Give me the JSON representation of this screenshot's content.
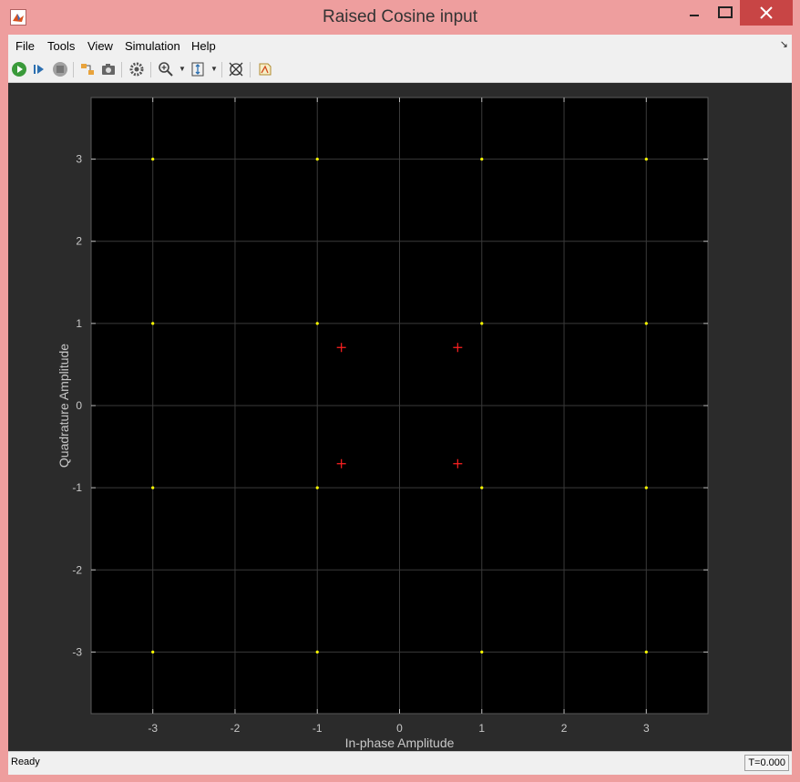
{
  "window": {
    "title": "Raised Cosine input"
  },
  "menu": {
    "file": "File",
    "tools": "Tools",
    "view": "View",
    "simulation": "Simulation",
    "help": "Help"
  },
  "toolbar": {
    "icons": [
      "run-icon",
      "step-forward-icon",
      "stop-icon",
      "highlight-block-icon",
      "snapshot-icon",
      "settings-icon",
      "zoom-in-icon",
      "scale-axes-icon",
      "axes-limits-icon",
      "print-icon"
    ]
  },
  "status": {
    "text": "Ready",
    "time": "T=0.000"
  },
  "colors": {
    "plot_bg": "#000000",
    "panel_bg": "#2b2b2b",
    "grid": "#3a3a3a",
    "axis_text": "#c8c8c8",
    "received_points": "#ffff00",
    "reference_points": "#ff2020"
  },
  "chart_data": {
    "type": "scatter",
    "title": "",
    "xlabel": "In-phase Amplitude",
    "ylabel": "Quadrature Amplitude",
    "xlim": [
      -3.75,
      3.75
    ],
    "ylim": [
      -3.75,
      3.75
    ],
    "xticks": [
      -3,
      -2,
      -1,
      0,
      1,
      2,
      3
    ],
    "yticks": [
      -3,
      -2,
      -1,
      0,
      1,
      2,
      3
    ],
    "grid": true,
    "series": [
      {
        "marker": "dot",
        "color": "#ffff00",
        "points": [
          [
            -3,
            3
          ],
          [
            -1,
            3
          ],
          [
            1,
            3
          ],
          [
            3,
            3
          ],
          [
            -3,
            1
          ],
          [
            -1,
            1
          ],
          [
            1,
            1
          ],
          [
            3,
            1
          ],
          [
            -3,
            -1
          ],
          [
            -1,
            -1
          ],
          [
            1,
            -1
          ],
          [
            3,
            -1
          ],
          [
            -3,
            -3
          ],
          [
            -1,
            -3
          ],
          [
            1,
            -3
          ],
          [
            3,
            -3
          ]
        ]
      },
      {
        "marker": "plus",
        "color": "#ff2020",
        "points": [
          [
            -0.707,
            0.707
          ],
          [
            0.707,
            0.707
          ],
          [
            -0.707,
            -0.707
          ],
          [
            0.707,
            -0.707
          ]
        ]
      }
    ]
  }
}
